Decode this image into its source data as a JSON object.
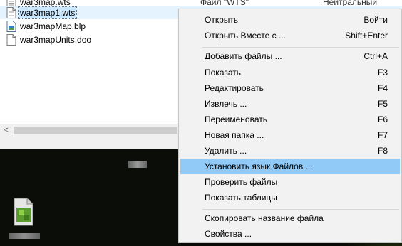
{
  "files": [
    {
      "name": "war3map.wts",
      "type": "Файл \"WTS\"",
      "extra": "Нейтральный",
      "icon": "text-file-icon",
      "selected": false
    },
    {
      "name": "war3map1.wts",
      "type": "",
      "extra": "",
      "icon": "text-file-icon",
      "selected": true
    },
    {
      "name": "war3mapMap.blp",
      "type": "",
      "extra": "",
      "icon": "image-file-icon",
      "selected": false
    },
    {
      "name": "war3mapUnits.doo",
      "type": "",
      "extra": "",
      "icon": "blank-file-icon",
      "selected": false
    }
  ],
  "scrollbar": {
    "left_arrow": "<"
  },
  "context_menu": {
    "items": [
      {
        "label": "Открыть",
        "shortcut": "Войти"
      },
      {
        "label": "Открыть Вместе с ...",
        "shortcut": "Shift+Enter"
      },
      {
        "label": "Добавить файлы ...",
        "shortcut": "Ctrl+A"
      },
      {
        "label": "Показать",
        "shortcut": "F3"
      },
      {
        "label": "Редактировать",
        "shortcut": "F4"
      },
      {
        "label": "Извлечь ...",
        "shortcut": "F5"
      },
      {
        "label": "Переименовать",
        "shortcut": "F6"
      },
      {
        "label": "Новая папка ...",
        "shortcut": "F7"
      },
      {
        "label": "Удалить ...",
        "shortcut": "F8"
      },
      {
        "label": "Установить язык Файлов ...",
        "shortcut": "",
        "highlighted": true
      },
      {
        "label": "Проверить файлы",
        "shortcut": ""
      },
      {
        "label": "Показать таблицы",
        "shortcut": ""
      },
      {
        "label": "Скопировать название файла",
        "shortcut": ""
      },
      {
        "label": "Свойства ...",
        "shortcut": ""
      }
    ]
  },
  "colors": {
    "highlight": "#91c9f7",
    "selection": "#cce8ff",
    "menu_bg": "#f2f2f2"
  }
}
